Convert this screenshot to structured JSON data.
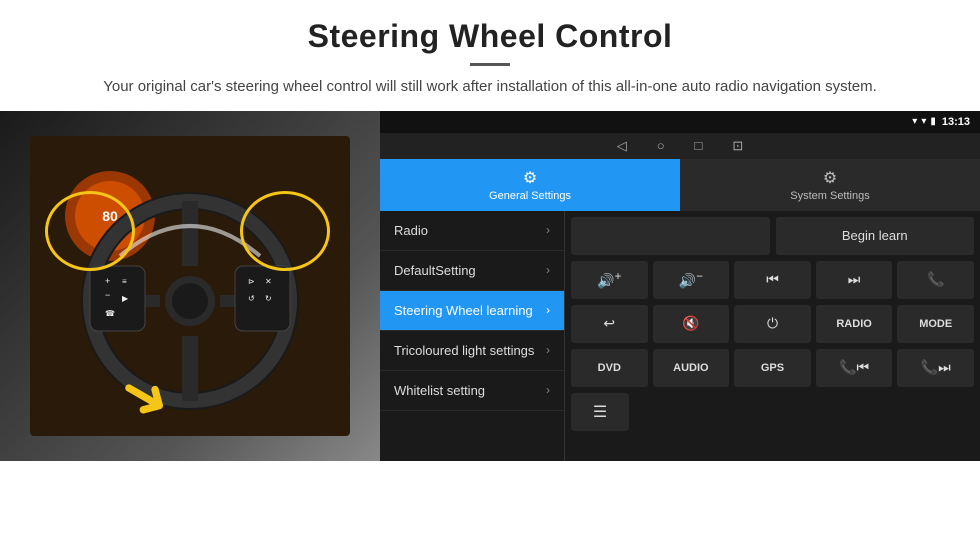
{
  "header": {
    "title": "Steering Wheel Control",
    "divider": true,
    "subtitle": "Your original car's steering wheel control will still work after installation of this all-in-one auto radio navigation system."
  },
  "statusBar": {
    "time": "13:13",
    "icons": [
      "▾",
      "▾",
      "●"
    ]
  },
  "navBar": {
    "icons": [
      "◁",
      "○",
      "□",
      "⊡"
    ]
  },
  "tabs": [
    {
      "id": "general",
      "label": "General Settings",
      "icon": "⚙",
      "active": true
    },
    {
      "id": "system",
      "label": "System Settings",
      "icon": "⚙",
      "active": false
    }
  ],
  "menu": {
    "items": [
      {
        "id": "radio",
        "label": "Radio",
        "active": false
      },
      {
        "id": "default",
        "label": "DefaultSetting",
        "active": false
      },
      {
        "id": "steering",
        "label": "Steering Wheel learning",
        "active": true
      },
      {
        "id": "tricoloured",
        "label": "Tricoloured light settings",
        "active": false
      },
      {
        "id": "whitelist",
        "label": "Whitelist setting",
        "active": false
      }
    ]
  },
  "rightPanel": {
    "beginLearnButton": "Begin learn",
    "controlButtons": {
      "row1": [
        {
          "icon": "🔊+",
          "type": "icon",
          "label": "vol-up"
        },
        {
          "icon": "🔊−",
          "type": "icon",
          "label": "vol-down"
        },
        {
          "icon": "⏮",
          "type": "icon",
          "label": "prev"
        },
        {
          "icon": "⏭",
          "type": "icon",
          "label": "next"
        },
        {
          "icon": "📞",
          "type": "icon",
          "label": "call"
        }
      ],
      "row2": [
        {
          "icon": "↩",
          "type": "icon",
          "label": "back"
        },
        {
          "icon": "🔊✕",
          "type": "icon",
          "label": "mute"
        },
        {
          "icon": "⏻",
          "type": "icon",
          "label": "power"
        },
        {
          "text": "RADIO",
          "type": "text",
          "label": "radio-btn"
        },
        {
          "text": "MODE",
          "type": "text",
          "label": "mode-btn"
        }
      ],
      "row3": [
        {
          "text": "DVD",
          "label": "dvd-btn"
        },
        {
          "text": "AUDIO",
          "label": "audio-btn"
        },
        {
          "text": "GPS",
          "label": "gps-btn"
        },
        {
          "icon": "📞⏮",
          "label": "call-prev-btn"
        },
        {
          "icon": "📞⏭",
          "label": "call-next-btn"
        }
      ],
      "row4": [
        {
          "icon": "≡",
          "label": "menu-icon-btn"
        }
      ]
    }
  }
}
